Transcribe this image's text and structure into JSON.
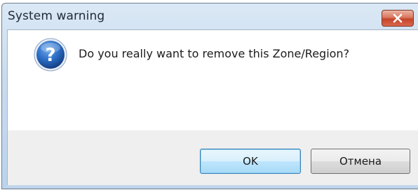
{
  "window": {
    "title": "System warning",
    "close_icon": "close-x-icon"
  },
  "dialog": {
    "icon": "question-icon",
    "message": "Do you really want to remove this Zone/Region?"
  },
  "buttons": {
    "ok_label": "OK",
    "cancel_label": "Отмена"
  },
  "colors": {
    "titlebar": "#c9dcef",
    "close_button": "#c5452a",
    "question_icon": "#1f5fb5",
    "footer": "#efefef",
    "default_button_border": "#3c7fb1"
  }
}
